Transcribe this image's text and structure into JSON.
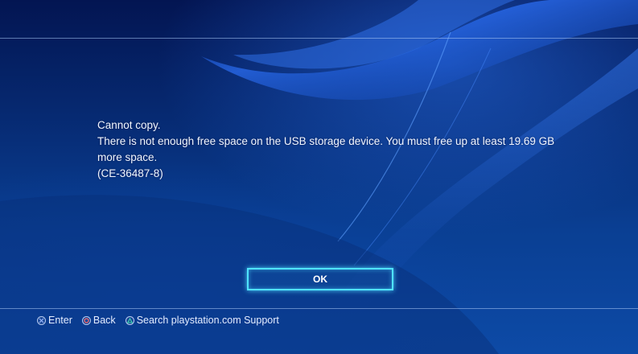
{
  "dialog": {
    "lines": [
      "Cannot copy.",
      "There is not enough free space on the USB storage device. You must free up at least 19.69 GB more space.",
      "(CE-36487-8)"
    ],
    "ok_label": "OK"
  },
  "footer": {
    "hints": [
      {
        "icon": "cross-button-icon",
        "label": "Enter"
      },
      {
        "icon": "circle-button-icon",
        "label": "Back"
      },
      {
        "icon": "triangle-button-icon",
        "label": "Search playstation.com Support"
      }
    ]
  },
  "colors": {
    "focus_glow": "#4fe3ff",
    "circle_button": "#ff6a6a",
    "triangle_button": "#40e0b0",
    "cross_button": "#9bb8ff"
  }
}
